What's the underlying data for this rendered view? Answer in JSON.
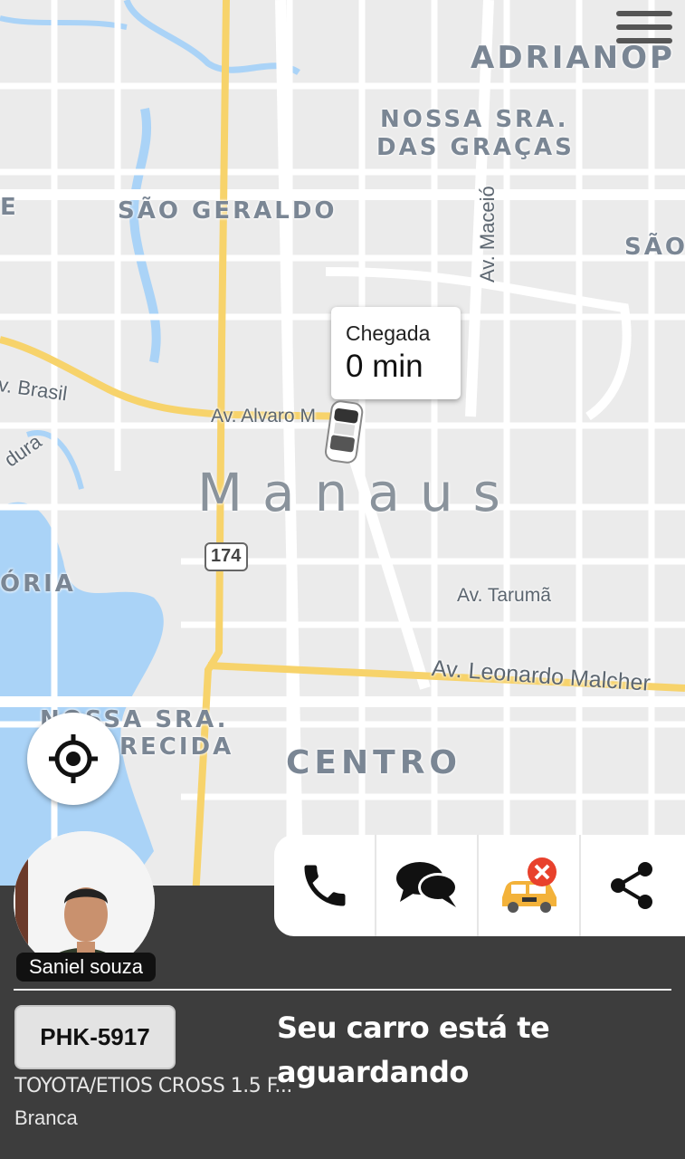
{
  "map": {
    "districts": {
      "adrianopolis": "ADRIANÓP",
      "nossa_sra_gracas_1": "NOSSA SRA.",
      "nossa_sra_gracas_2": "DAS GRAÇAS",
      "sao_geraldo": "SÃO GERALDO",
      "sao_right": "SÃO",
      "manaus": "Manaus",
      "oria": "ÓRIA",
      "nossa_sra_aparecida_1": "NOSSA SRA.",
      "nossa_sra_aparecida_2": "RECIDA",
      "centro": "CENTRO",
      "e_left": "E"
    },
    "streets": {
      "av_brasil": "v. Brasil",
      "av_alvaro": "Av. Alvaro M",
      "av_maceio": "Av. Maceió",
      "av_taruma": "Av. Tarumã",
      "av_leonardo": "Av. Leonardo Malcher",
      "dura": "dura",
      "route_174": "174"
    },
    "colors": {
      "water": "#aad3f7",
      "major_road": "#f7d36b",
      "road": "#ffffff",
      "land": "#ebebeb"
    }
  },
  "eta": {
    "title": "Chegada",
    "value": "0 min"
  },
  "driver": {
    "name": "Saniel souza"
  },
  "actions": [
    {
      "icon": "phone-icon"
    },
    {
      "icon": "chat-icon"
    },
    {
      "icon": "cancel-taxi-icon"
    },
    {
      "icon": "share-icon"
    }
  ],
  "vehicle": {
    "plate": "PHK-5917",
    "model": "TOYOTA/ETIOS CROSS 1.5 F...",
    "color": "Branca"
  },
  "status_message": "Seu carro está te aguardando"
}
